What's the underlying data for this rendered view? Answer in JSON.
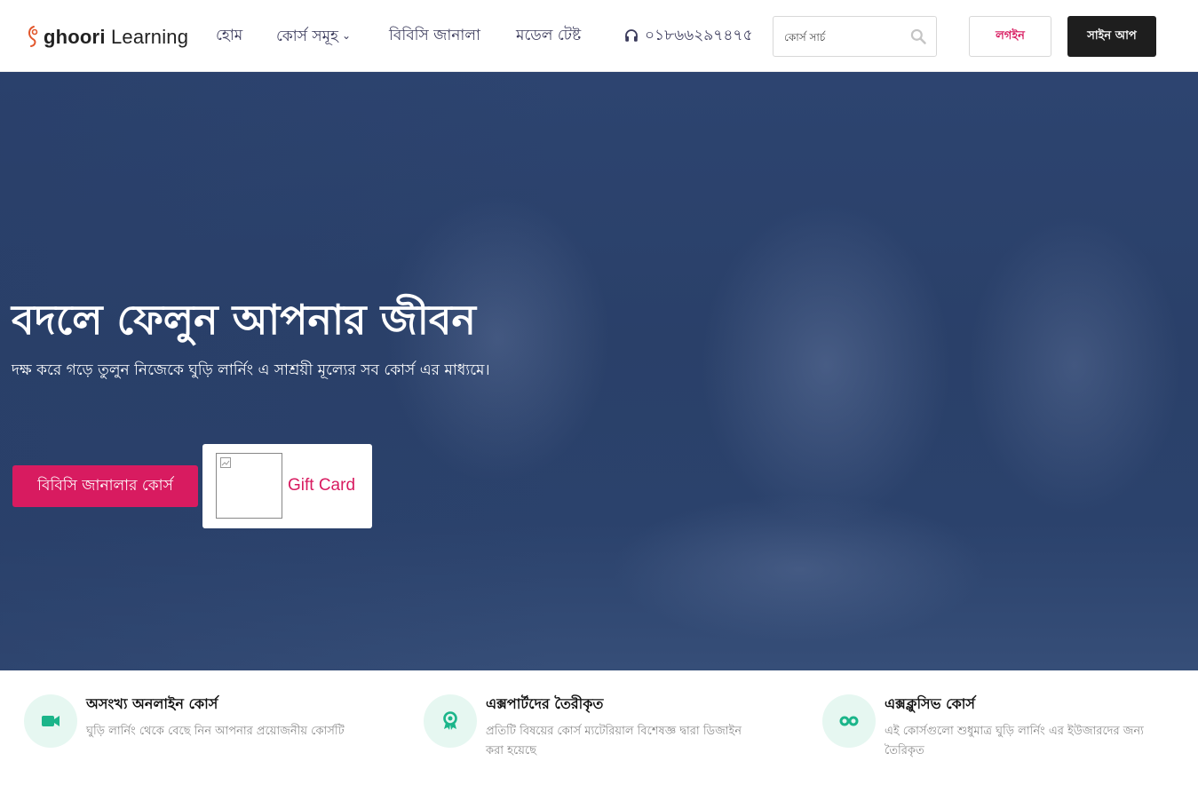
{
  "brand": {
    "logo_text_bold": "ghoori",
    "logo_text": " Learning"
  },
  "nav": {
    "items": [
      {
        "label": "হোম"
      },
      {
        "label": "কোর্স সমূহ"
      },
      {
        "label": "বিবিসি জানালা"
      },
      {
        "label": "মডেল টেষ্ট"
      }
    ],
    "phone": "০১৮৬৬২৯৭৪৭৫"
  },
  "search": {
    "placeholder": "কোর্স সার্চ"
  },
  "auth": {
    "login_label": "লগইন",
    "signup_label": "সাইন আপ"
  },
  "hero": {
    "title": "বদলে ফেলুন আপনার জীবন",
    "subtitle": "দক্ষ করে গড়ে তুলুন নিজেকে ঘুড়ি লার্নিং এ সাশ্রয়ী মূল্যের সব কোর্স এর মাধ্যমে।",
    "cta_label": "বিবিসি জানালার কোর্স",
    "gift_card_label": "Gift Card"
  },
  "features": [
    {
      "icon": "video-camera-icon",
      "title": "অসংখ্য অনলাইন কোর্স",
      "desc": "ঘুড়ি লার্নিং থেকে বেছে নিন আপনার প্রয়োজনীয় কোর্সটি"
    },
    {
      "icon": "award-icon",
      "title": "এক্সপার্টদের তৈরীকৃত",
      "desc": "প্রতিটি বিষয়ের কোর্স ম্যটেরিয়াল বিশেষজ্ঞ দ্বারা ডিজাইন করা হয়েছে"
    },
    {
      "icon": "infinity-icon",
      "title": "এক্সক্লুসিভ কোর্স",
      "desc": "এই কোর্সগুলো শুধুমাত্র ঘুড়ি লার্নিং এর ইউজারদের জন্য তৈরিকৃত"
    }
  ],
  "colors": {
    "accent": "#d81b60",
    "hero_overlay": "#2d4470",
    "feature_icon": "#1bb58a",
    "dark_button": "#1e1e1e"
  }
}
